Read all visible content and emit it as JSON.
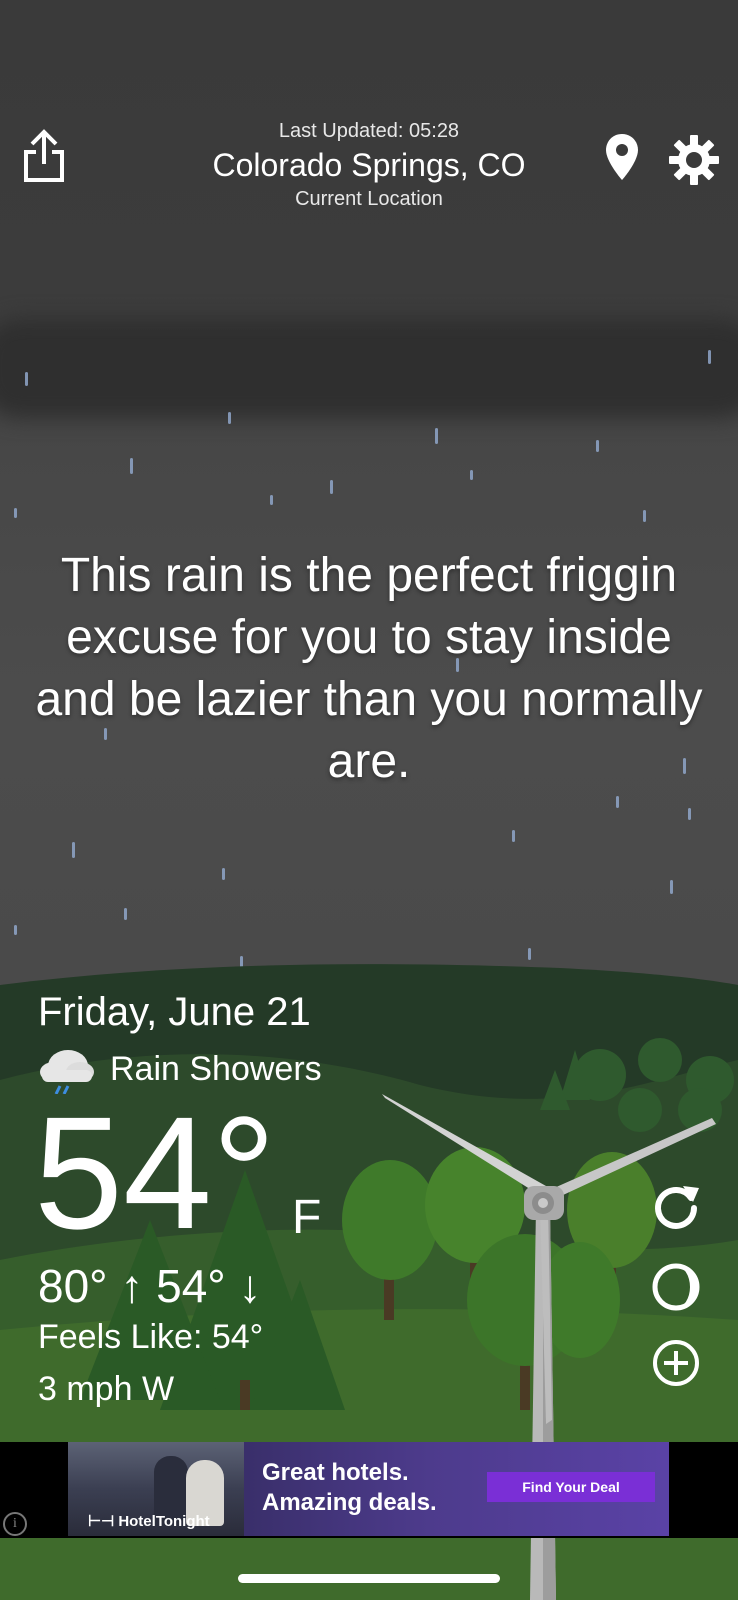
{
  "header": {
    "last_updated": "Last Updated: 05:28",
    "city": "Colorado Springs, CO",
    "location_label": "Current Location"
  },
  "quote": "This rain is the perfect friggin excuse for you to stay inside and be lazier than you normally are.",
  "weather": {
    "date": "Friday, June 21",
    "condition": "Rain Showers",
    "condition_icon": "rain-cloud-icon",
    "temperature": "54°",
    "unit": "F",
    "high_low": "80° ↑  54° ↓",
    "feels_like": "Feels Like: 54°",
    "wind": "3 mph W"
  },
  "actions": {
    "share_icon": "share-icon",
    "location_icon": "map-pin-icon",
    "settings_icon": "gear-icon",
    "refresh_icon": "refresh-icon",
    "moon_icon": "moon-phase-icon",
    "add_icon": "add-circle-icon"
  },
  "ad": {
    "headline_line1": "Great hotels.",
    "headline_line2": "Amazing deals.",
    "cta": "Find Your Deal",
    "brand": "HotelTonight",
    "info": "i"
  },
  "colors": {
    "sky": "#3c3c3c",
    "grass": "#3f6b2c",
    "ad_purple": "#7a2fd6"
  }
}
